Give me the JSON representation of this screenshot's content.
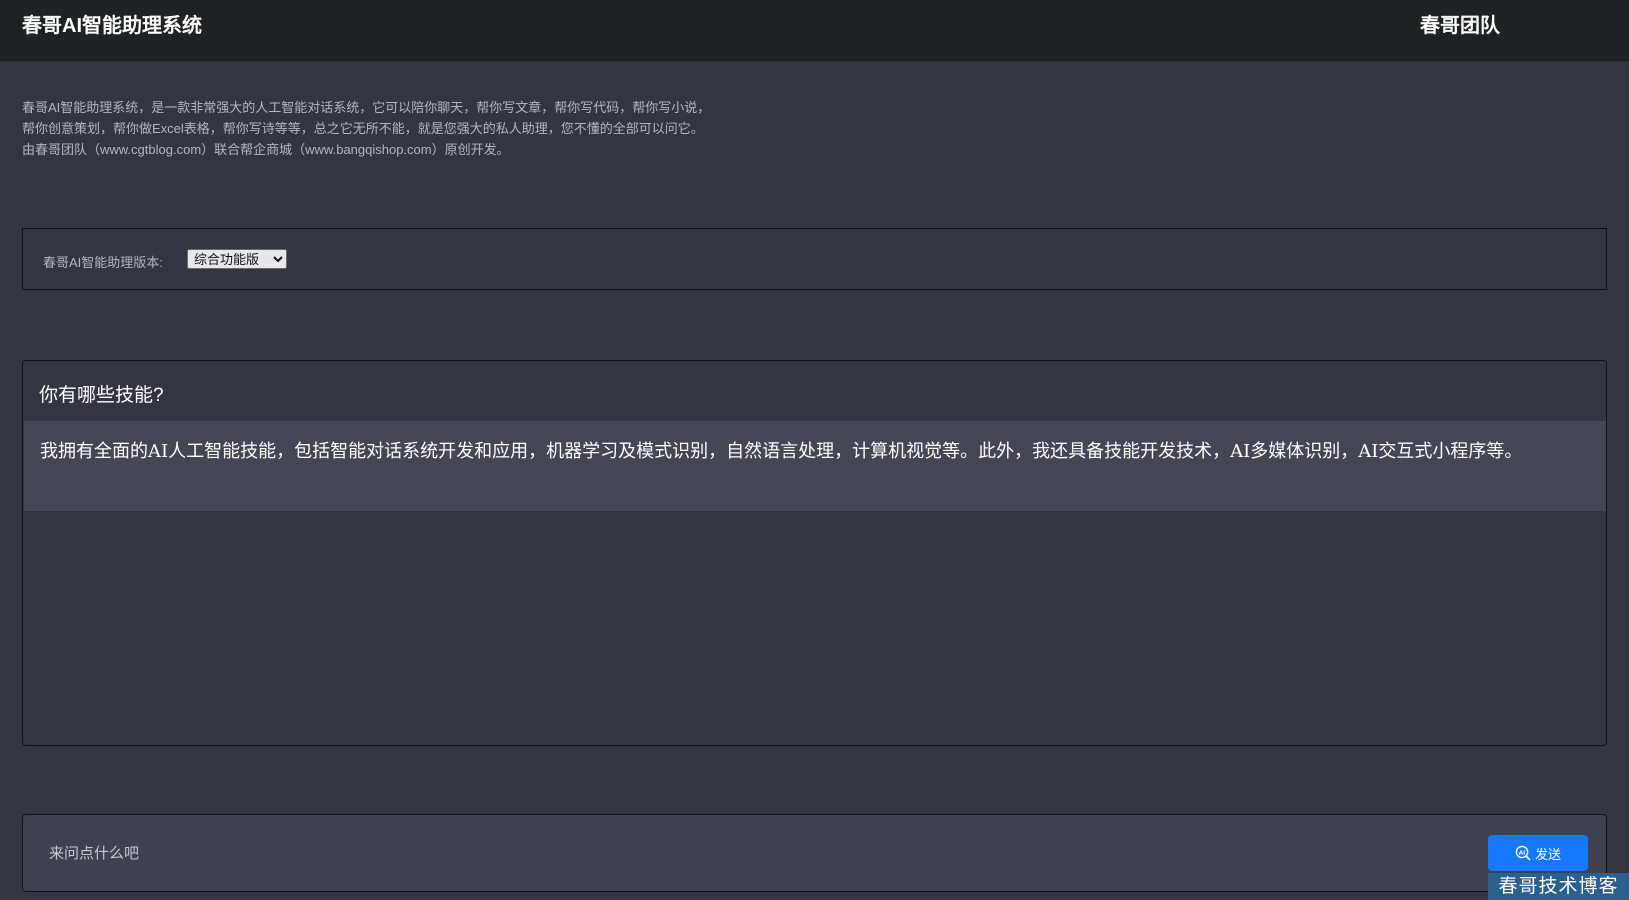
{
  "header": {
    "app_title": "春哥AI智能助理系统",
    "team_label": "春哥团队"
  },
  "intro": {
    "lines": [
      "春哥AI智能助理系统，是一款非常强大的人工智能对话系统，它可以陪你聊天，帮你写文章，帮你写代码，帮你写小说，",
      "帮你创意策划，帮你做Excel表格，帮你写诗等等，总之它无所不能，就是您强大的私人助理，您不懂的全部可以问它。",
      "由春哥团队（www.cgtblog.com）联合帮企商城（www.bangqishop.com）原创开发。"
    ]
  },
  "version": {
    "label": "春哥AI智能助理版本:",
    "selected": "综合功能版"
  },
  "chat": {
    "question": "你有哪些技能?",
    "answer": "我拥有全面的AI人工智能技能，包括智能对话系统开发和应用，机器学习及模式识别，自然语言处理，计算机视觉等。此外，我还具备技能开发技术，AI多媒体识别，AI交互式小程序等。"
  },
  "composer": {
    "placeholder": "来问点什么吧",
    "send_label": "发送",
    "send_icon": "ai-search-icon",
    "accent": "#1677ff"
  },
  "watermark": {
    "text": "春哥技术博客"
  }
}
